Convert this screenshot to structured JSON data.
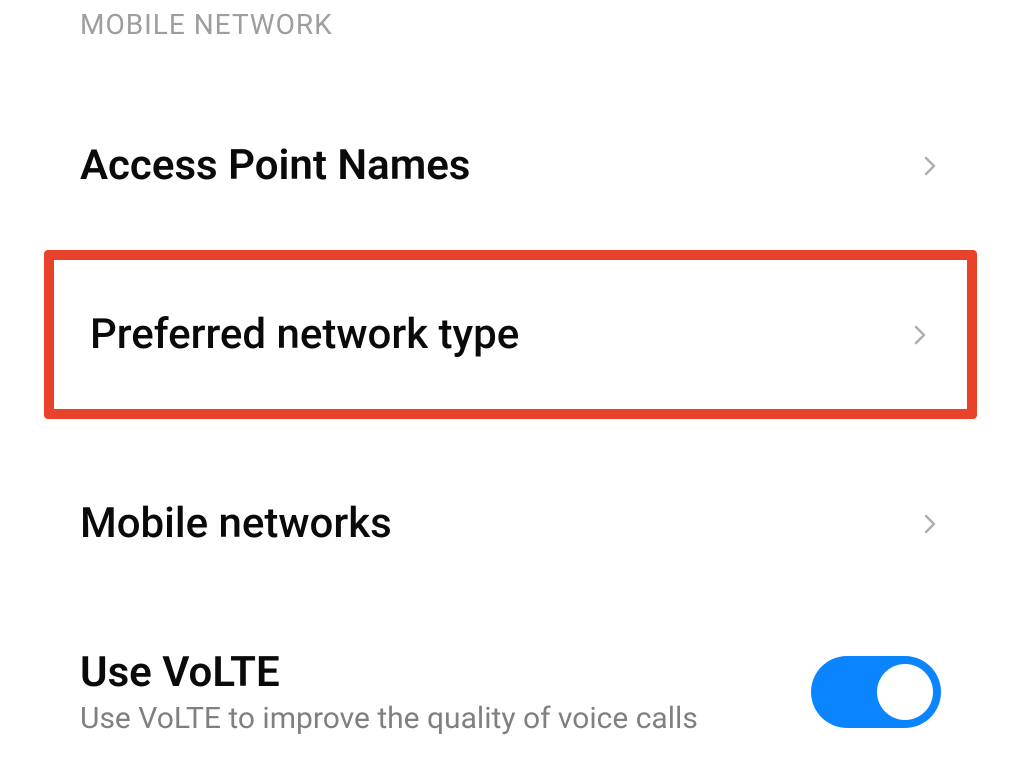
{
  "section": {
    "title": "MOBILE NETWORK"
  },
  "items": {
    "apn": {
      "label": "Access Point Names"
    },
    "preferred": {
      "label": "Preferred network type"
    },
    "mobile_networks": {
      "label": "Mobile networks"
    },
    "volte": {
      "title": "Use VoLTE",
      "subtitle": "Use VoLTE to improve the quality of voice calls",
      "enabled": true
    }
  }
}
